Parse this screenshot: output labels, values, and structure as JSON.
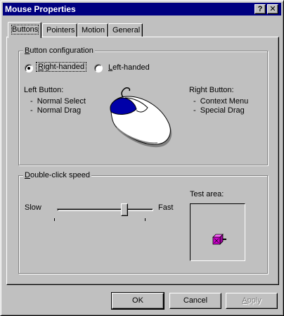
{
  "window": {
    "title": "Mouse Properties",
    "help_button": "?",
    "close_button": "✕"
  },
  "tabs": [
    {
      "label": "Buttons",
      "active": true
    },
    {
      "label": "Pointers",
      "active": false
    },
    {
      "label": "Motion",
      "active": false
    },
    {
      "label": "General",
      "active": false
    }
  ],
  "button_config": {
    "group_label": "Button configuration",
    "right_handed_label": "Right-handed",
    "left_handed_label": "Left-handed",
    "selected": "right-handed",
    "left_button": {
      "heading": "Left Button:",
      "items": [
        "Normal Select",
        "Normal Drag"
      ]
    },
    "right_button": {
      "heading": "Right Button:",
      "items": [
        "Context Menu",
        "Special Drag"
      ]
    },
    "item_bullet": "-"
  },
  "double_click": {
    "group_label": "Double-click speed",
    "slow_label": "Slow",
    "fast_label": "Fast",
    "speed_fraction": 0.72,
    "test_area_label": "Test area:"
  },
  "buttons": {
    "ok": "OK",
    "cancel": "Cancel",
    "apply": "Apply"
  },
  "colors": {
    "titlebar": "#000080",
    "face": "#c0c0c0",
    "mouse_button": "#0000a8",
    "jack_box": "#cc00cc"
  }
}
